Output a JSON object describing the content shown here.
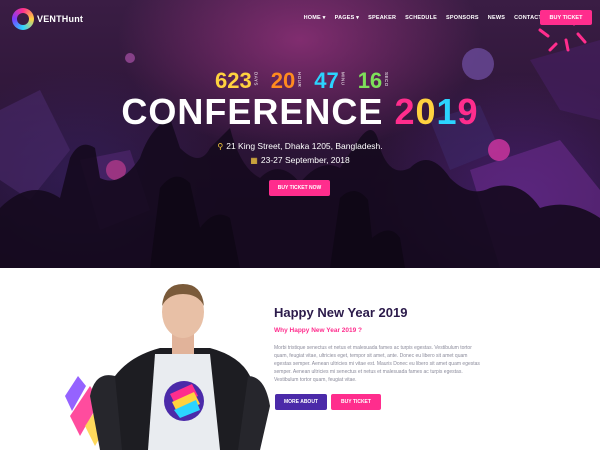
{
  "brand": {
    "logo_text": "VENTHunt"
  },
  "nav": {
    "items": [
      {
        "label": "HOME ▾"
      },
      {
        "label": "PAGES ▾"
      },
      {
        "label": "SPEAKER"
      },
      {
        "label": "SCHEDULE"
      },
      {
        "label": "SPONSORS"
      },
      {
        "label": "NEWS"
      },
      {
        "label": "CONTACT"
      }
    ],
    "ticket_button": "BUY TICKET"
  },
  "countdown": [
    {
      "value": "623",
      "label": "DAYS",
      "color": "#ffd23f"
    },
    {
      "value": "20",
      "label": "HOUR",
      "color": "#ff8a1f"
    },
    {
      "value": "47",
      "label": "MINU",
      "color": "#2bd4ff"
    },
    {
      "value": "16",
      "label": "SECO",
      "color": "#7ee05a"
    }
  ],
  "hero": {
    "title_word": "CONFERENCE",
    "year": [
      "2",
      "0",
      "1",
      "9"
    ],
    "location": "21 King Street, Dhaka 1205, Bangladesh.",
    "dates": "23-27 September, 2018",
    "cta": "BUY TICKET NOW"
  },
  "about": {
    "title": "Happy New Year 2019",
    "subtitle": "Why Happy New Year 2019 ?",
    "body": "Morbi tristique senectus et netus et malesuada fames ac turpis egestas. Vestibulum tortor quam, feugiat vitae, ultricies eget, tempor sit amet, ante. Donec eu libero sit amet quam egestas semper. Aenean ultricies mi vitae est. Mauris Donec eu libero sit amet quam egestas semper. Aenean ultricies mi senectus et netus et malesuada fames ac turpis egestas. Vestibulum tortor quam, feugiat vitae.",
    "more_button": "MORE ABOUT",
    "ticket_button": "BUY TICKET"
  },
  "colors": {
    "accent_pink": "#ff2d8d",
    "accent_purple": "#4b2aa9",
    "heading": "#2b1a4a"
  },
  "icons": {
    "location": "map-pin-icon",
    "date": "calendar-icon"
  }
}
